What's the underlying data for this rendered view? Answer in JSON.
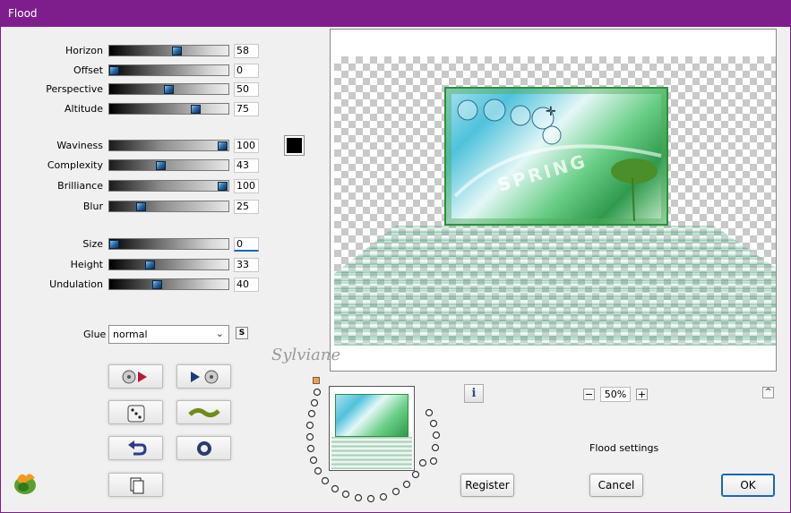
{
  "window": {
    "title": "Flood"
  },
  "sliders_group1": [
    {
      "label": "Horizon",
      "value": "58",
      "fraction": 0.58
    },
    {
      "label": "Offset",
      "value": "0",
      "fraction": 0.0
    },
    {
      "label": "Perspective",
      "value": "50",
      "fraction": 0.5
    },
    {
      "label": "Altitude",
      "value": "75",
      "fraction": 0.75
    }
  ],
  "sliders_group2": [
    {
      "label": "Waviness",
      "value": "100",
      "fraction": 1.0
    },
    {
      "label": "Complexity",
      "value": "43",
      "fraction": 0.43
    },
    {
      "label": "Brilliance",
      "value": "100",
      "fraction": 1.0
    },
    {
      "label": "Blur",
      "value": "25",
      "fraction": 0.25
    }
  ],
  "sliders_group3": [
    {
      "label": "Size",
      "value": "0",
      "fraction": 0.0
    },
    {
      "label": "Height",
      "value": "33",
      "fraction": 0.33
    },
    {
      "label": "Undulation",
      "value": "40",
      "fraction": 0.4
    }
  ],
  "glue": {
    "label": "Glue",
    "value": "normal",
    "s_button": "S"
  },
  "color_swatch": "#000000",
  "preview": {
    "image_text": "SPRING",
    "watermark": "Sylviane"
  },
  "zoom": {
    "value": "50%",
    "minus": "−",
    "plus": "+"
  },
  "info_label": "i",
  "collapse_label": "^",
  "status": "Flood settings",
  "buttons": {
    "register": "Register",
    "cancel": "Cancel",
    "ok": "OK"
  },
  "colors": {
    "titlebar": "#7e1e8c",
    "accent": "#1d66b5"
  }
}
